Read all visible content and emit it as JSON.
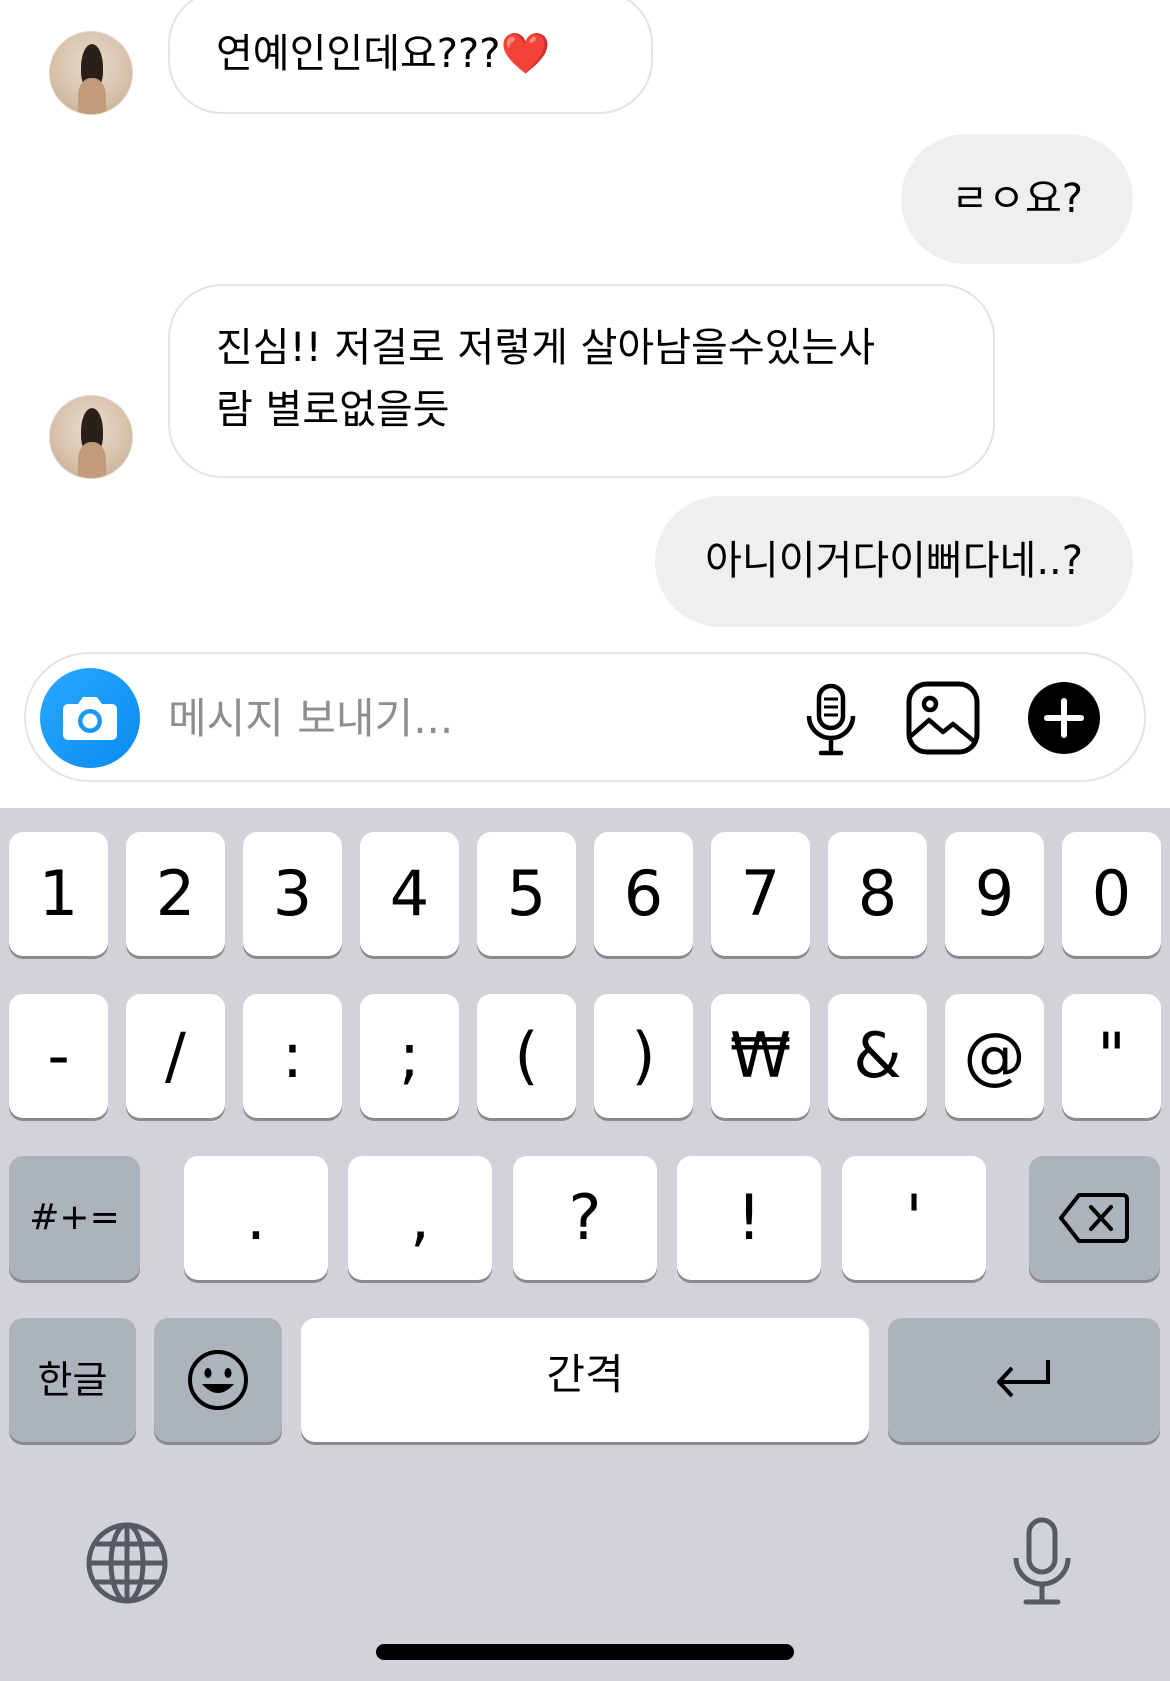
{
  "messages": [
    {
      "side": "in",
      "text": "연예인인데요???❤️"
    },
    {
      "side": "out",
      "text": "ㄹㅇ요?"
    },
    {
      "side": "in",
      "line1": "진심!! 저걸로 저렇게 살아남을수있는사",
      "line2": "람 별로없을듯"
    },
    {
      "side": "out",
      "text": "아니이거다이뻐다네..?"
    }
  ],
  "composer": {
    "placeholder": "메시지 보내기...",
    "icons": [
      "camera-icon",
      "microphone-icon",
      "gallery-icon",
      "plus-icon"
    ],
    "accent": "#1a98f6"
  },
  "keyboard": {
    "numbers": [
      "1",
      "2",
      "3",
      "4",
      "5",
      "6",
      "7",
      "8",
      "9",
      "0"
    ],
    "symbols": [
      "-",
      "/",
      ":",
      ";",
      "(",
      ")",
      "₩",
      "&",
      "@",
      "\""
    ],
    "row3": {
      "shift_label": "#+=",
      "keys": [
        ".",
        ",",
        "?",
        "!",
        "'"
      ]
    },
    "row4": {
      "lang_label": "한글",
      "space_label": "간격"
    },
    "bottom_icons": [
      "globe-icon",
      "dictation-icon"
    ]
  }
}
